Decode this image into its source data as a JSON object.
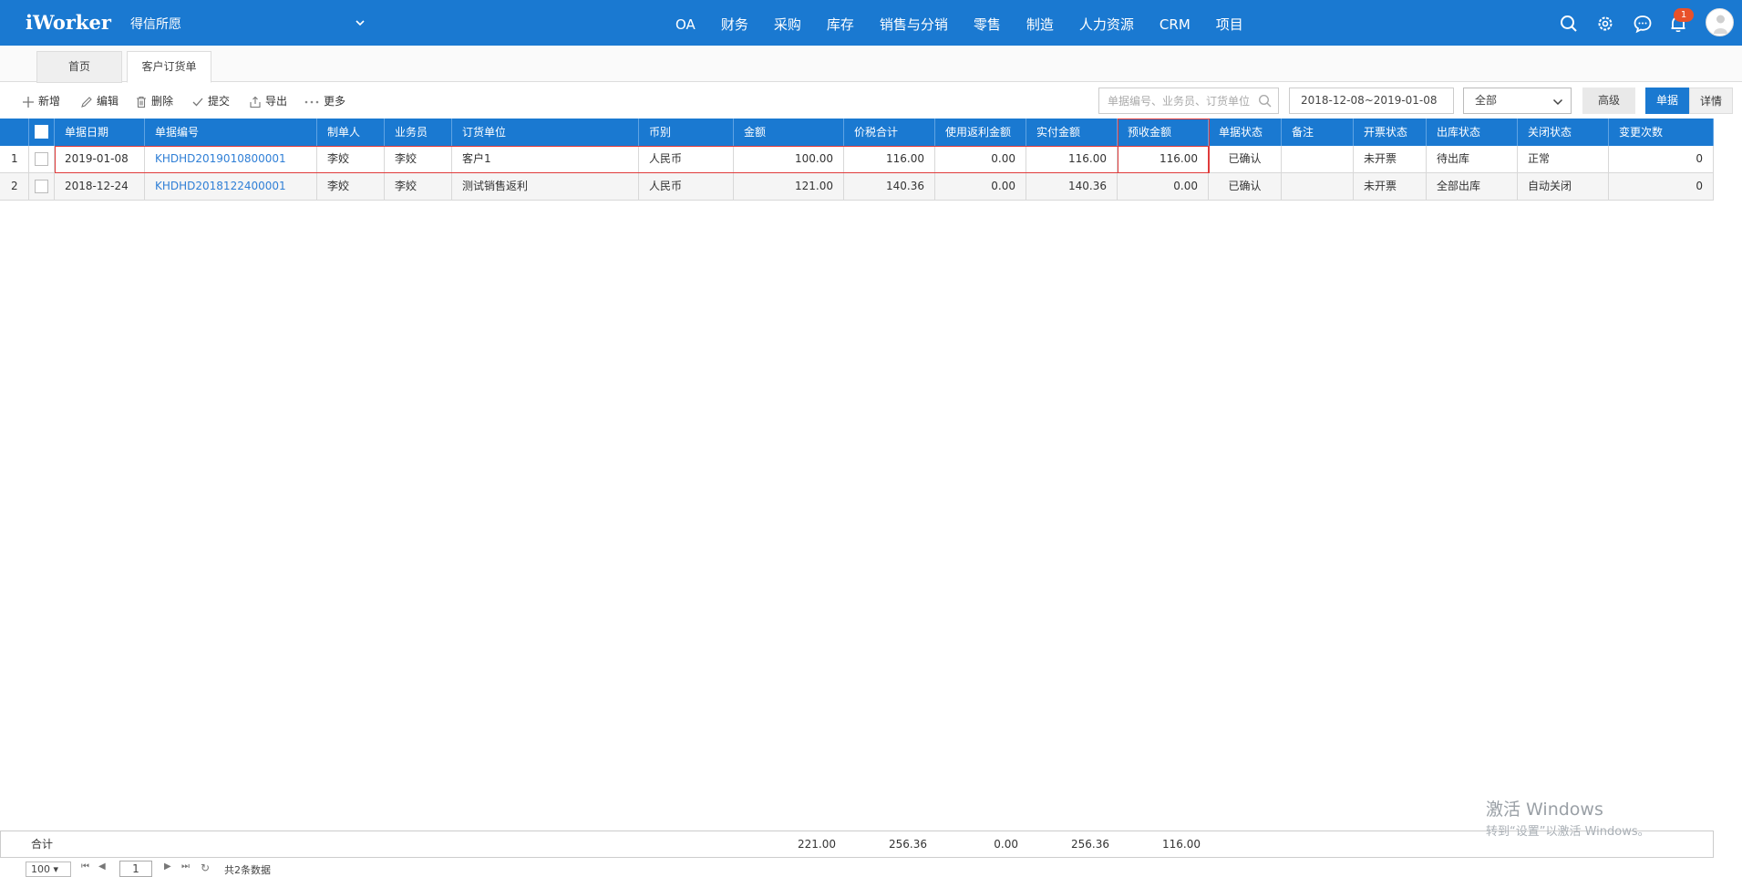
{
  "app": {
    "logo": "iWorker",
    "company": "得信所愿"
  },
  "nav": [
    "OA",
    "财务",
    "采购",
    "库存",
    "销售与分销",
    "零售",
    "制造",
    "人力资源",
    "CRM",
    "项目"
  ],
  "notifications": {
    "count": "1"
  },
  "tabs": [
    {
      "label": "首页"
    },
    {
      "label": "客户订货单"
    }
  ],
  "toolbar": {
    "add": "新增",
    "edit": "编辑",
    "delete": "删除",
    "submit": "提交",
    "export": "导出",
    "more": "更多",
    "search_placeholder": "单据编号、业务员、订货单位",
    "date_range": "2018-12-08~2019-01-08",
    "status_select": "全部",
    "advanced": "高级",
    "view_doc": "单据",
    "view_detail": "详情"
  },
  "table": {
    "columns": [
      "单据日期",
      "单据编号",
      "制单人",
      "业务员",
      "订货单位",
      "币别",
      "金额",
      "价税合计",
      "使用返利金额",
      "实付金额",
      "预收金额",
      "单据状态",
      "备注",
      "开票状态",
      "出库状态",
      "关闭状态",
      "变更次数"
    ],
    "rows": [
      {
        "no": "1",
        "date": "2019-01-08",
        "code": "KHDHD2019010800001",
        "maker": "李姣",
        "salesman": "李姣",
        "customer": "客户1",
        "currency": "人民币",
        "amount": "100.00",
        "total": "116.00",
        "rebate": "0.00",
        "paid": "116.00",
        "prepaid": "116.00",
        "status": "已确认",
        "remark": "",
        "invoice": "未开票",
        "outbound": "待出库",
        "close": "正常",
        "changes": "0"
      },
      {
        "no": "2",
        "date": "2018-12-24",
        "code": "KHDHD2018122400001",
        "maker": "李姣",
        "salesman": "李姣",
        "customer": "测试销售返利",
        "currency": "人民币",
        "amount": "121.00",
        "total": "140.36",
        "rebate": "0.00",
        "paid": "140.36",
        "prepaid": "0.00",
        "status": "已确认",
        "remark": "",
        "invoice": "未开票",
        "outbound": "全部出库",
        "close": "自动关闭",
        "changes": "0"
      }
    ]
  },
  "summary": {
    "label": "合计",
    "amount": "221.00",
    "total": "256.36",
    "rebate": "0.00",
    "paid": "256.36",
    "prepaid": "116.00"
  },
  "pager": {
    "page_size": "100",
    "page": "1",
    "total_text": "共2条数据"
  },
  "watermark": {
    "line1": "激活 Windows",
    "line2": "转到“设置”以激活 Windows。"
  },
  "colors": {
    "brand": "#1a79d1",
    "highlight": "#e03b3b",
    "link": "#2f7fd6"
  }
}
